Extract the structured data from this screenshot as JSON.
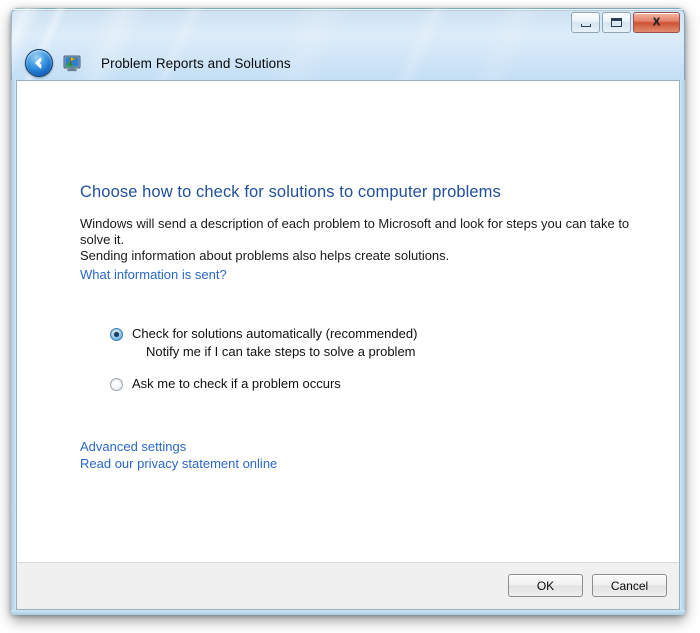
{
  "window": {
    "title": "Problem Reports and Solutions",
    "icon": "problem-reports-monitor-icon",
    "back_label": "Back",
    "caption": {
      "minimize_label": "Minimize",
      "maximize_label": "Maximize",
      "close_label": "Close",
      "close_glyph": "X"
    },
    "colors": {
      "glass_top": "#cfe2f2",
      "glass_bottom": "#bcdcf4",
      "frame_border": "#7ba7c4",
      "close_button": "#cf5334",
      "heading_blue": "#21509c",
      "link_blue": "#2968c8",
      "client_background": "#ffffff",
      "footer_background": "#f0f0f0"
    }
  },
  "main": {
    "heading": "Choose how to check for solutions to computer problems",
    "description_line1": "Windows will send a description of each problem to Microsoft and look for steps you can take to solve it.",
    "description_line2": "Sending information about problems also helps create solutions.",
    "info_link": "What information is sent?",
    "options": [
      {
        "id": "automatic",
        "label": "Check for solutions automatically (recommended)",
        "sublabel": "Notify me if I can take steps to solve a problem",
        "checked": true
      },
      {
        "id": "ask",
        "label": "Ask me to check if a problem occurs",
        "sublabel": "",
        "checked": false
      }
    ],
    "links": [
      {
        "id": "advanced-settings",
        "label": "Advanced settings"
      },
      {
        "id": "privacy-statement",
        "label": "Read our privacy statement online"
      }
    ]
  },
  "footer": {
    "ok_label": "OK",
    "cancel_label": "Cancel"
  }
}
